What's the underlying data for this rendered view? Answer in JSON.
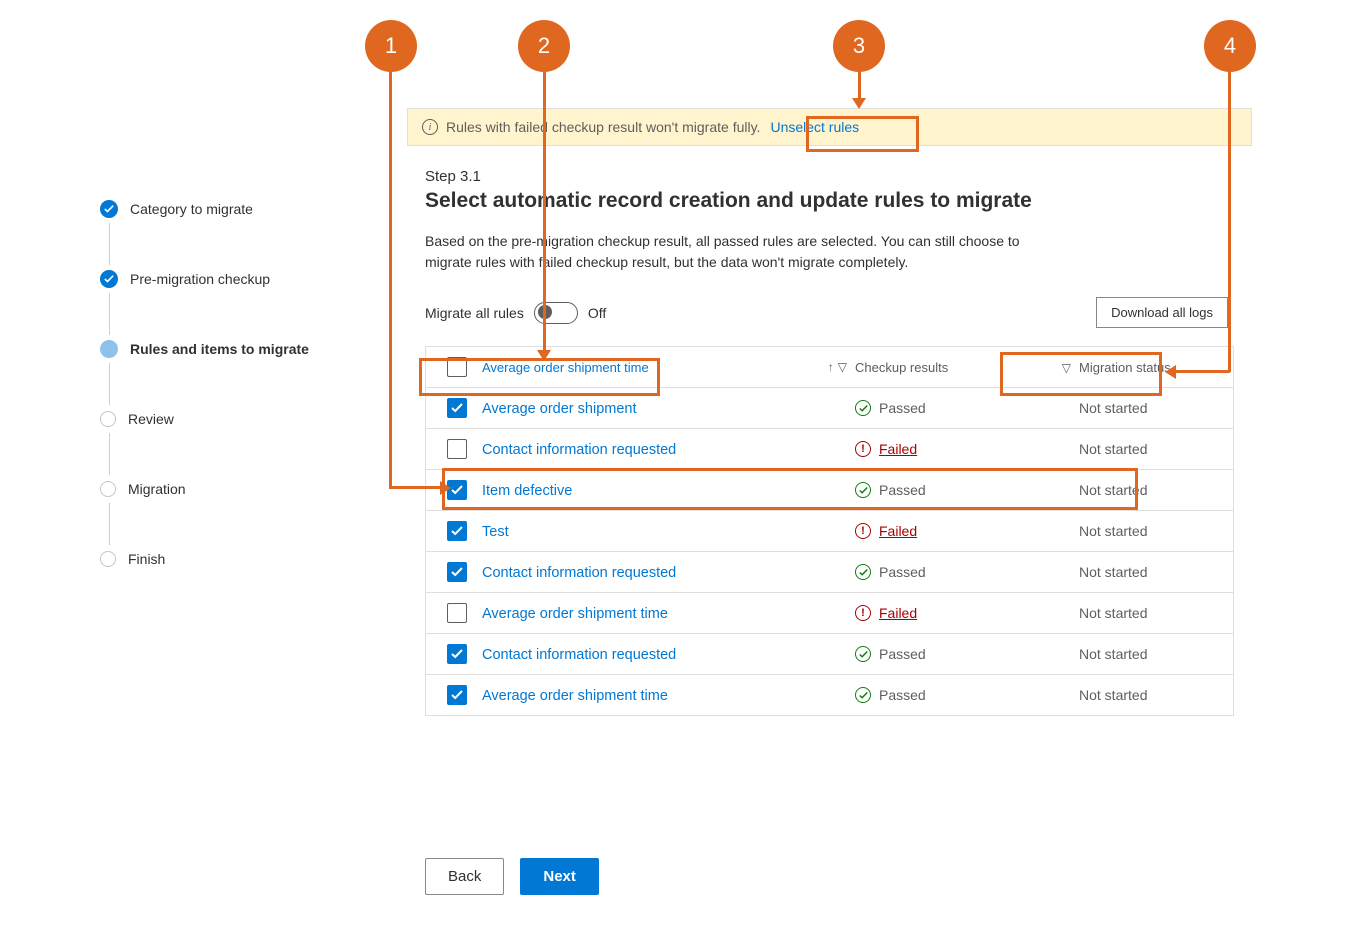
{
  "sidebar": {
    "steps": [
      {
        "label": "Category to migrate",
        "state": "complete"
      },
      {
        "label": "Pre-migration checkup",
        "state": "complete"
      },
      {
        "label": "Rules and items to migrate",
        "state": "current"
      },
      {
        "label": "Review",
        "state": "future"
      },
      {
        "label": "Migration",
        "state": "future"
      },
      {
        "label": "Finish",
        "state": "future"
      }
    ]
  },
  "infobar": {
    "text": "Rules with failed checkup result won't migrate fully.",
    "link": "Unselect rules"
  },
  "step": {
    "number": "Step 3.1",
    "title": "Select automatic record creation and update rules to migrate",
    "description": "Based on the pre-migration checkup result, all passed rules are selected. You can still choose to migrate rules with failed checkup result, but the data won't migrate completely."
  },
  "toggle": {
    "label": "Migrate all rules",
    "state": "Off"
  },
  "download_button": "Download all logs",
  "table": {
    "headers": {
      "name": "Average order shipment time",
      "checkup": "Checkup results",
      "migration": "Migration status"
    },
    "rows": [
      {
        "checked": true,
        "name": "Average order shipment",
        "result": "Passed",
        "migration": "Not started"
      },
      {
        "checked": false,
        "name": "Contact information requested",
        "result": "Failed",
        "migration": "Not started"
      },
      {
        "checked": true,
        "name": "Item defective",
        "result": "Passed",
        "migration": "Not started"
      },
      {
        "checked": true,
        "name": "Test",
        "result": "Failed",
        "migration": "Not started"
      },
      {
        "checked": true,
        "name": "Contact information requested",
        "result": "Passed",
        "migration": "Not started"
      },
      {
        "checked": false,
        "name": "Average order shipment time",
        "result": "Failed",
        "migration": "Not started"
      },
      {
        "checked": true,
        "name": "Contact information requested",
        "result": "Passed",
        "migration": "Not started"
      },
      {
        "checked": true,
        "name": "Average order shipment time",
        "result": "Passed",
        "migration": "Not started"
      }
    ]
  },
  "footer": {
    "back": "Back",
    "next": "Next"
  },
  "callouts": [
    "1",
    "2",
    "3",
    "4"
  ]
}
